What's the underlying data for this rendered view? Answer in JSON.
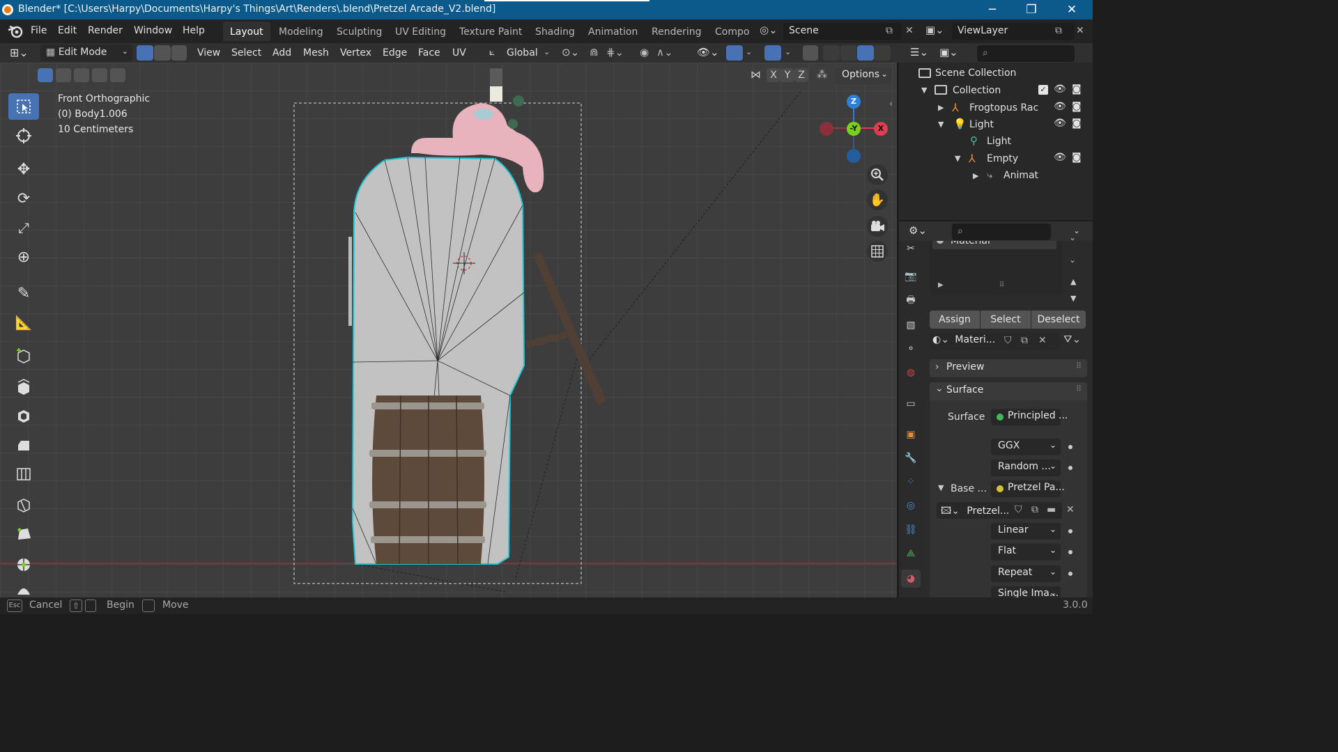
{
  "window": {
    "title": "Blender* [C:\\Users\\Harpy\\Documents\\Harpy's Things\\Art\\Renders\\.blend\\Pretzel Arcade_V2.blend]",
    "minimize": "─",
    "maximize": "❐",
    "close": "✕"
  },
  "menu": {
    "file": "File",
    "edit": "Edit",
    "render": "Render",
    "window": "Window",
    "help": "Help"
  },
  "workspaces": [
    "Layout",
    "Modeling",
    "Sculpting",
    "UV Editing",
    "Texture Paint",
    "Shading",
    "Animation",
    "Rendering",
    "Compo"
  ],
  "scene": "Scene",
  "view_layer": "ViewLayer",
  "header": {
    "mode": "Edit Mode",
    "view": "View",
    "select": "Select",
    "add": "Add",
    "mesh": "Mesh",
    "vertex": "Vertex",
    "edge": "Edge",
    "face": "Face",
    "uv": "UV",
    "orientation": "Global",
    "options": "Options",
    "axis_x": "X",
    "axis_y": "Y",
    "axis_z": "Z"
  },
  "viewport": {
    "view_name": "Front Orthographic",
    "object": "(0) Body1.006",
    "scale": "10 Centimeters",
    "gizmo_z": "Z",
    "gizmo_y": "-Y",
    "gizmo_x": "X"
  },
  "outliner": {
    "scene_collection": "Scene Collection",
    "collection": "Collection",
    "item1": "Frogtopus Rac",
    "item2": "Light",
    "item3": "Light",
    "item4": "Empty",
    "item5": "Animat"
  },
  "properties": {
    "material_slot": "Material",
    "assign": "Assign",
    "select": "Select",
    "deselect": "Deselect",
    "material_name": "Materi...",
    "preview": "Preview",
    "surface_panel": "Surface",
    "surface_label": "Surface",
    "surface_value": "Principled ...",
    "distribution": "GGX",
    "subsurface": "Random ...",
    "base_label": "Base ...",
    "base_value": "Pretzel Pa...",
    "image_name": "Pretzel...",
    "interpolation": "Linear",
    "projection": "Flat",
    "extension": "Repeat",
    "source": "Single Ima..."
  },
  "status": {
    "esc": "Esc",
    "cancel": "Cancel",
    "begin": "Begin",
    "move": "Move",
    "version": "3.0.0"
  },
  "colors": {
    "accent": "#4772b3",
    "title_bar": "#0c5a8c",
    "mesh_outline": "#22c7d4",
    "x_axis": "#e03c4f",
    "y_axis": "#7bcf1f",
    "z_axis": "#2f7fd8"
  }
}
